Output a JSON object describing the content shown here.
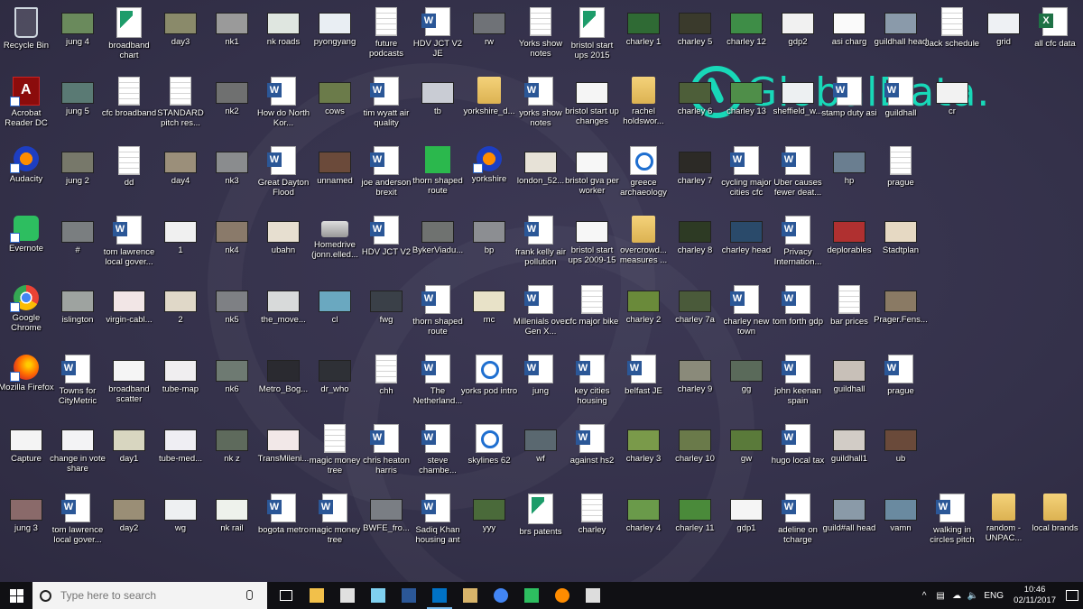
{
  "logo": {
    "text": "GlobalData."
  },
  "icons": [
    {
      "label": "Recycle Bin",
      "type": "bin"
    },
    {
      "label": "jung 4",
      "type": "img",
      "color": "#6a8a5c"
    },
    {
      "label": "broadband chart",
      "type": "chart"
    },
    {
      "label": "day3",
      "type": "img",
      "color": "#8a8a6a"
    },
    {
      "label": "nk1",
      "type": "img",
      "color": "#9a9a9a"
    },
    {
      "label": "nk roads",
      "type": "img",
      "color": "#dfe6e0"
    },
    {
      "label": "pyongyang",
      "type": "img",
      "color": "#e9eef3"
    },
    {
      "label": "future podcasts",
      "type": "doc"
    },
    {
      "label": "HDV JCT V2 JE",
      "type": "word"
    },
    {
      "label": "rw",
      "type": "img",
      "color": "#6f7277"
    },
    {
      "label": "Yorks show notes",
      "type": "doc"
    },
    {
      "label": "bristol start ups 2015",
      "type": "chart"
    },
    {
      "label": "charley 1",
      "type": "img",
      "color": "#2f6a34"
    },
    {
      "label": "charley 5",
      "type": "img",
      "color": "#3a3a2c"
    },
    {
      "label": "charley 12",
      "type": "img",
      "color": "#3e8d47"
    },
    {
      "label": "gdp2",
      "type": "img",
      "color": "#f1f1f1"
    },
    {
      "label": "asi charg",
      "type": "img",
      "color": "#fafafa"
    },
    {
      "label": "guildhall head",
      "type": "img",
      "color": "#8a9aaa"
    },
    {
      "label": "Jack schedule",
      "type": "doc"
    },
    {
      "label": "grid",
      "type": "img",
      "color": "#eef1f4"
    },
    {
      "label": "all cfc data",
      "type": "excel"
    },
    {
      "label": "Acrobat Reader DC",
      "type": "acro"
    },
    {
      "label": "jung 5",
      "type": "img",
      "color": "#5a7a74"
    },
    {
      "label": "cfc broadband",
      "type": "doc"
    },
    {
      "label": "STANDARD pitch res...",
      "type": "doc"
    },
    {
      "label": "nk2",
      "type": "img",
      "color": "#6f7070"
    },
    {
      "label": "How do North Kor...",
      "type": "word"
    },
    {
      "label": "cows",
      "type": "img",
      "color": "#6b7b4a"
    },
    {
      "label": "tim wyatt air quality",
      "type": "word"
    },
    {
      "label": "tb",
      "type": "img",
      "color": "#c9ccd4"
    },
    {
      "label": "yorkshire_d...",
      "type": "folder"
    },
    {
      "label": "yorks show notes",
      "type": "word"
    },
    {
      "label": "bristol start up changes",
      "type": "img",
      "color": "#f5f5f5"
    },
    {
      "label": "rachel holdswor...",
      "type": "folder"
    },
    {
      "label": "charley 6",
      "type": "img",
      "color": "#4d5e39"
    },
    {
      "label": "charley 13",
      "type": "img",
      "color": "#4f8e49"
    },
    {
      "label": "sheffield_w...",
      "type": "img",
      "color": "#edf0f2"
    },
    {
      "label": "stamp duty asi",
      "type": "word"
    },
    {
      "label": "guildhall",
      "type": "word"
    },
    {
      "label": "cr",
      "type": "img",
      "color": "#f2f2f2"
    },
    {
      "label": "Audacity",
      "type": "aud"
    },
    {
      "label": "jung 2",
      "type": "img",
      "color": "#77786a"
    },
    {
      "label": "dd",
      "type": "doc"
    },
    {
      "label": "day4",
      "type": "img",
      "color": "#9b8f7a"
    },
    {
      "label": "nk3",
      "type": "img",
      "color": "#8a8c8e"
    },
    {
      "label": "Great Dayton Flood",
      "type": "word"
    },
    {
      "label": "unnamed",
      "type": "img",
      "color": "#6b4a3a"
    },
    {
      "label": "joe anderson brexit",
      "type": "word"
    },
    {
      "label": "thorn shaped route",
      "type": "map"
    },
    {
      "label": "yorkshire",
      "type": "aud"
    },
    {
      "label": "london_52...",
      "type": "img",
      "color": "#e7e2d7"
    },
    {
      "label": "bristol gva per worker",
      "type": "img",
      "color": "#f7f7f7"
    },
    {
      "label": "greece archaeology",
      "type": "pod"
    },
    {
      "label": "charley 7",
      "type": "img",
      "color": "#2c2a26"
    },
    {
      "label": "cycling major cities cfc",
      "type": "word"
    },
    {
      "label": "Uber causes fewer deat...",
      "type": "word"
    },
    {
      "label": "hp",
      "type": "img",
      "color": "#6a7e90"
    },
    {
      "label": "prague",
      "type": "doc"
    },
    {
      "label": "Evernote",
      "type": "ever"
    },
    {
      "label": "#",
      "type": "img",
      "color": "#7a7e80"
    },
    {
      "label": "tom lawrence local gover...",
      "type": "word"
    },
    {
      "label": "1",
      "type": "img",
      "color": "#f0f0f0"
    },
    {
      "label": "nk4",
      "type": "img",
      "color": "#8a7a6a"
    },
    {
      "label": "ubahn",
      "type": "img",
      "color": "#e7dfd0"
    },
    {
      "label": "Homedrive (jonn.elled...",
      "type": "drive"
    },
    {
      "label": "HDV JCT V2",
      "type": "word"
    },
    {
      "label": "BykerViadu...",
      "type": "img",
      "color": "#6f7270"
    },
    {
      "label": "bp",
      "type": "img",
      "color": "#8c8e92"
    },
    {
      "label": "frank kelly air pollution",
      "type": "word"
    },
    {
      "label": "bristol start ups 2009-15",
      "type": "img",
      "color": "#f7f7f7"
    },
    {
      "label": "overcrowd... measures ...",
      "type": "folder"
    },
    {
      "label": "charley 8",
      "type": "img",
      "color": "#2d3a24"
    },
    {
      "label": "charley head",
      "type": "img",
      "color": "#2a4a6a"
    },
    {
      "label": "Privacy Internation...",
      "type": "word"
    },
    {
      "label": "deplorables",
      "type": "img",
      "color": "#b03030"
    },
    {
      "label": "Stadtplan",
      "type": "img",
      "color": "#e6d9c3"
    },
    {
      "label": "Google Chrome",
      "type": "chrome"
    },
    {
      "label": "islington",
      "type": "img",
      "color": "#9ea3a0"
    },
    {
      "label": "virgin-cabl...",
      "type": "img",
      "color": "#f2e6e6"
    },
    {
      "label": "2",
      "type": "img",
      "color": "#e0d8c8"
    },
    {
      "label": "nk5",
      "type": "img",
      "color": "#7e8084"
    },
    {
      "label": "the_move...",
      "type": "img",
      "color": "#d8dada"
    },
    {
      "label": "cl",
      "type": "img",
      "color": "#6aa8c0"
    },
    {
      "label": "fwg",
      "type": "img",
      "color": "#3a4048"
    },
    {
      "label": "thorn shaped route",
      "type": "word"
    },
    {
      "label": "mc",
      "type": "img",
      "color": "#e8e2c8"
    },
    {
      "label": "Millenials over Gen X...",
      "type": "word"
    },
    {
      "label": "cfc major bike",
      "type": "doc"
    },
    {
      "label": "charley 2",
      "type": "img",
      "color": "#6a8a3a"
    },
    {
      "label": "charley 7a",
      "type": "img",
      "color": "#4a5a3a"
    },
    {
      "label": "charley new town",
      "type": "word"
    },
    {
      "label": "tom forth gdp",
      "type": "word"
    },
    {
      "label": "bar prices",
      "type": "doc"
    },
    {
      "label": "Prager.Fens...",
      "type": "img",
      "color": "#8a7a64"
    },
    {
      "label": "Mozilla Firefox",
      "type": "ff"
    },
    {
      "label": "Towns for CityMetric",
      "type": "word"
    },
    {
      "label": "broadband scatter",
      "type": "img",
      "color": "#f5f5f5"
    },
    {
      "label": "tube-map",
      "type": "img",
      "color": "#f0eef0"
    },
    {
      "label": "nk6",
      "type": "img",
      "color": "#6e7a72"
    },
    {
      "label": "Metro_Bog...",
      "type": "img",
      "color": "#2a2a30"
    },
    {
      "label": "dr_who",
      "type": "img",
      "color": "#2e3036"
    },
    {
      "label": "chh",
      "type": "doc"
    },
    {
      "label": "The Netherland...",
      "type": "word"
    },
    {
      "label": "yorks pod intro",
      "type": "pod"
    },
    {
      "label": "jung",
      "type": "word"
    },
    {
      "label": "key cities housing",
      "type": "word"
    },
    {
      "label": "belfast JE",
      "type": "word"
    },
    {
      "label": "charley 9",
      "type": "img",
      "color": "#8a8a7a"
    },
    {
      "label": "gg",
      "type": "img",
      "color": "#5a6a5a"
    },
    {
      "label": "john keenan spain",
      "type": "word"
    },
    {
      "label": "guildhall",
      "type": "img",
      "color": "#c8c0b8"
    },
    {
      "label": "prague",
      "type": "word"
    },
    {
      "label": "Capture",
      "type": "img",
      "color": "#f4f4f4"
    },
    {
      "label": "change in vote share",
      "type": "img",
      "color": "#f3f3f5"
    },
    {
      "label": "day1",
      "type": "img",
      "color": "#d8d6c0"
    },
    {
      "label": "tube-med...",
      "type": "img",
      "color": "#efeef3"
    },
    {
      "label": "nk z",
      "type": "img",
      "color": "#5e6a5c"
    },
    {
      "label": "TransMileni...",
      "type": "img",
      "color": "#f2e8e8"
    },
    {
      "label": "magic money tree",
      "type": "doc"
    },
    {
      "label": "chris heaton harris",
      "type": "word"
    },
    {
      "label": "steve chambe...",
      "type": "word"
    },
    {
      "label": "skylines 62",
      "type": "pod"
    },
    {
      "label": "wf",
      "type": "img",
      "color": "#5a6870"
    },
    {
      "label": "against hs2",
      "type": "word"
    },
    {
      "label": "charley 3",
      "type": "img",
      "color": "#7a9a4a"
    },
    {
      "label": "charley 10",
      "type": "img",
      "color": "#6a7a4a"
    },
    {
      "label": "gw",
      "type": "img",
      "color": "#5a7a3a"
    },
    {
      "label": "hugo local tax",
      "type": "word"
    },
    {
      "label": "guildhall1",
      "type": "img",
      "color": "#d2ccc6"
    },
    {
      "label": "ub",
      "type": "img",
      "color": "#6a4a3a"
    },
    {
      "label": "jung 3",
      "type": "img",
      "color": "#8a6a6a"
    },
    {
      "label": "tom lawrence local gover...",
      "type": "word"
    },
    {
      "label": "day2",
      "type": "img",
      "color": "#9a8e76"
    },
    {
      "label": "wg",
      "type": "img",
      "color": "#eef0f2"
    },
    {
      "label": "nk rail",
      "type": "img",
      "color": "#eef2ec"
    },
    {
      "label": "bogota metro",
      "type": "word"
    },
    {
      "label": "magic money tree",
      "type": "word"
    },
    {
      "label": "BWFE_fro...",
      "type": "img",
      "color": "#7a7e84"
    },
    {
      "label": "Sadiq Khan housing ant",
      "type": "word"
    },
    {
      "label": "yyy",
      "type": "img",
      "color": "#4a6a3a"
    },
    {
      "label": "brs patents",
      "type": "chart"
    },
    {
      "label": "charley",
      "type": "doc"
    },
    {
      "label": "charley 4",
      "type": "img",
      "color": "#6a9a4a"
    },
    {
      "label": "charley 11",
      "type": "img",
      "color": "#4a8a3a"
    },
    {
      "label": "gdp1",
      "type": "img",
      "color": "#f5f5f5"
    },
    {
      "label": "adeline on tcharge",
      "type": "word"
    },
    {
      "label": "guild#all head",
      "type": "img",
      "color": "#8a9aa8"
    },
    {
      "label": "vamn",
      "type": "img",
      "color": "#6a8aa0"
    },
    {
      "label": "walking in circles pitch",
      "type": "word"
    },
    {
      "label": "random - UNPAC...",
      "type": "folder"
    },
    {
      "label": "local brands",
      "type": "folder"
    }
  ],
  "taskbar": {
    "search_placeholder": "Type here to search",
    "apps": [
      {
        "name": "task-view",
        "icon": "task-view-icon",
        "color": "#ffffff"
      },
      {
        "name": "file-explorer",
        "icon": "folder-icon",
        "color": "#f2c04a"
      },
      {
        "name": "paint",
        "icon": "paint-icon",
        "color": "#e0e0e0"
      },
      {
        "name": "notepad",
        "icon": "pen-icon",
        "color": "#7fd0f0"
      },
      {
        "name": "word",
        "icon": "word-icon",
        "color": "#2b5797"
      },
      {
        "name": "outlook",
        "icon": "outlook-icon",
        "color": "#0072c6"
      },
      {
        "name": "paint-palette",
        "icon": "palette-icon",
        "color": "#d8b46a"
      },
      {
        "name": "chrome",
        "icon": "chrome-icon",
        "color": "#4285f4"
      },
      {
        "name": "evernote",
        "icon": "evernote-icon",
        "color": "#2dbe60"
      },
      {
        "name": "audacity",
        "icon": "audacity-icon",
        "color": "#ff8c00"
      },
      {
        "name": "calculator",
        "icon": "calculator-icon",
        "color": "#dddddd"
      }
    ],
    "language": "ENG",
    "time": "10:46",
    "date": "02/11/2017"
  }
}
